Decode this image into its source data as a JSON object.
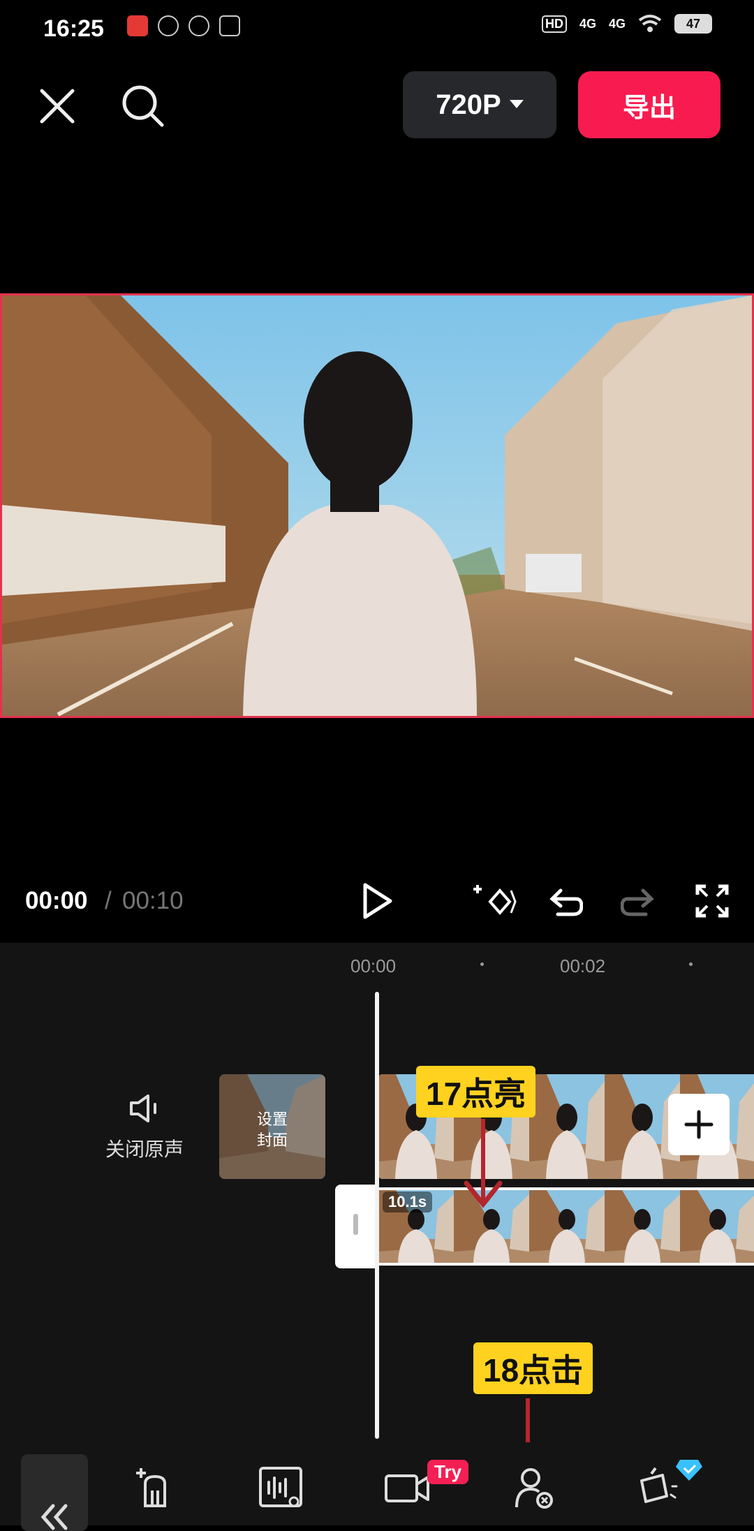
{
  "status_bar": {
    "time": "16:25",
    "network_1": "4G",
    "network_2": "4G",
    "battery": "47"
  },
  "top_bar": {
    "resolution": "720P",
    "export_label": "导出"
  },
  "playback": {
    "current_time": "00:00",
    "separator": "/",
    "total_time": "00:10"
  },
  "timeline": {
    "ruler": [
      "00:00",
      "00:02"
    ],
    "mute_label": "关闭原声",
    "cover_label_line1": "设置",
    "cover_label_line2": "封面",
    "clip_duration": "10.1s"
  },
  "annotations": {
    "step_17": "17点亮",
    "step_18": "18点击"
  },
  "toolbar": {
    "try_badge": "Try"
  },
  "colors": {
    "accent": "#f81b4f",
    "annotation": "#ffd21f",
    "arrow": "#b3262e"
  }
}
